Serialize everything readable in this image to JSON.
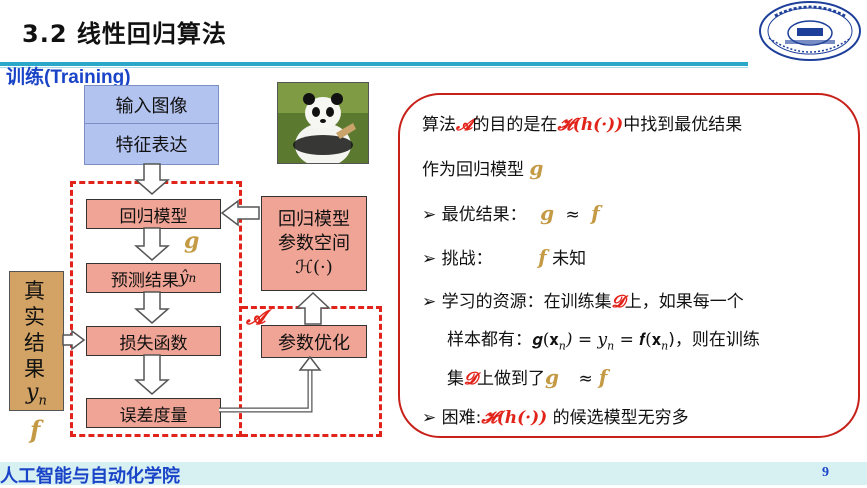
{
  "header": {
    "title": "3.2  线性回归算法",
    "subtitle": "训练(Training)"
  },
  "flow": {
    "input_image": "输入图像",
    "feature": "特征表达",
    "regression_model": "回归模型",
    "g_label": "g",
    "prediction": "预测结果",
    "prediction_sym": "ŷ",
    "prediction_sub": "n",
    "loss": "损失函数",
    "error": "误差度量",
    "ground_truth": [
      "真",
      "实",
      "结",
      "果"
    ],
    "ground_truth_sym": "y",
    "ground_truth_sub": "n",
    "f_label": "f",
    "model_space_1": "回归模型",
    "model_space_2": "参数空间",
    "model_space_3": "ℋ(·)",
    "param_opt": "参数优化",
    "algo_label": "𝓐"
  },
  "panel": {
    "line1_a": "算法",
    "line1_algo": "𝓐",
    "line1_b": "的目的是在",
    "line1_H": "𝓗(𝒉(·))",
    "line1_c": "中找到最优结果",
    "line2_a": "作为回归模型",
    "line2_g": "g",
    "b1_label": "最优结果：",
    "b1_g": "g",
    "b1_approx": "≈",
    "b1_f": "f",
    "b2_label": "挑战：",
    "b2_f": "f",
    "b2_tail": "未知",
    "b3_a": "学习的资源：在训练集",
    "b3_D": "𝓓",
    "b3_b": "上，如果每一个",
    "b3_line2_a": "样本都有：",
    "b3_eq": "𝒈(𝐱",
    "b3_eq_sub": "n",
    "b3_eq_mid": ") = y",
    "b3_eq_mid_sub": "n",
    "b3_eq_end": " = 𝒇(𝐱",
    "b3_eq_end_sub": "n",
    "b3_eq_close": ")，则在训练",
    "b3_line3_a": "集",
    "b3_line3_D": "𝓓",
    "b3_line3_b": "上做到了",
    "b3_line3_g": "g",
    "b3_line3_approx": "≈",
    "b3_line3_f": "f",
    "b4_a": "困难:",
    "b4_H": "𝓗(𝒉(·))",
    "b4_b": "的候选模型无穷多"
  },
  "footer": {
    "text": "人工智能与自动化学院",
    "page": "9"
  },
  "colors": {
    "accent_blue": "#1a44c8",
    "accent_red": "#e2231a",
    "gold": "#c49a45"
  },
  "icons": {
    "logo": "university-seal-icon",
    "photo": "panda-image"
  }
}
